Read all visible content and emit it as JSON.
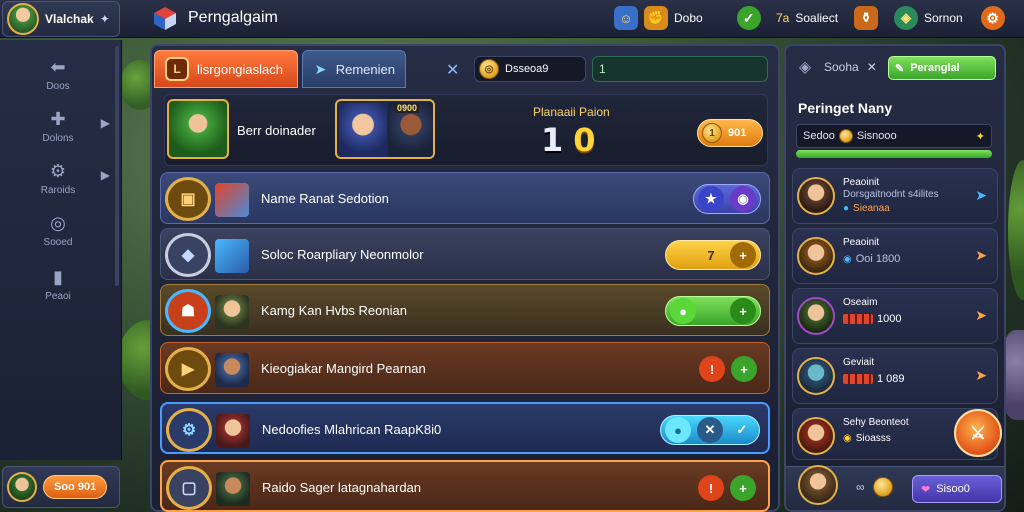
{
  "topbar": {
    "player_name": "Vlalchak",
    "player_gear": "✦",
    "app_title": "Perngalgaim",
    "res1_label": "Dobo",
    "res2_prefix": "7a",
    "res2_label": "Soaliect",
    "res3_label": "Sornon"
  },
  "left_rail": {
    "items": [
      {
        "label": "Doos",
        "icon": "back-arrow-icon"
      },
      {
        "label": "Dolons",
        "icon": "puzzle-icon"
      },
      {
        "label": "Raroids",
        "icon": "gear-people-icon"
      },
      {
        "label": "Sooed",
        "icon": "target-icon"
      },
      {
        "label": "Peaoi",
        "icon": "chart-icon"
      }
    ],
    "bottom_label": "Soo 901"
  },
  "main": {
    "tab_active": "lisrgongiaslach",
    "tab_active_emblem": "L",
    "tab_second": "Remenien",
    "close_symbol": "✕",
    "gold_coin_symbol": "◎",
    "gold_value": "Dsseoa9",
    "green_value": "1",
    "match": {
      "player_name": "Berr doinader",
      "opp_badge": "0900",
      "score_label": "Planaaii Paion",
      "score_left": "1",
      "score_right": "0",
      "reward_value": "901",
      "reward_coin": "1"
    },
    "quests": [
      {
        "title": "Name Ranat Sedotion",
        "emblem": "▣",
        "actions": [
          "★",
          "◉"
        ]
      },
      {
        "title": "Soloc Roarpliary Neonmolor",
        "emblem": "◆",
        "actions": [
          "7",
          "+"
        ]
      },
      {
        "title": "Kamg Kan Hvbs Reonian",
        "emblem": "☗",
        "actions": [
          "●",
          "+"
        ]
      },
      {
        "title": "Kieogiakar Mangird Pearnan",
        "emblem": "▶",
        "actions": [
          "!",
          "+"
        ]
      },
      {
        "title": "Nedoofies Mlahrican RaapK8i0",
        "emblem": "⚙",
        "actions": [
          "●",
          "✕",
          "✓"
        ]
      },
      {
        "title": "Raido Sager latagnahardan",
        "emblem": "▢",
        "actions": [
          "!",
          "+"
        ]
      }
    ]
  },
  "right": {
    "tab_label": "Sooha",
    "tab_close": "✕",
    "green_btn": "Peranglal",
    "heading": "Peringet Nany",
    "search_label": "Sedoo",
    "search_value": "Sisnooo",
    "progress_pct": 100,
    "rows": [
      {
        "name": "Peaoinit",
        "sub": "Dorsgaitnodnt s4ilites",
        "meta": "Sieanaa",
        "arrow": "➤"
      },
      {
        "name": "Peaoinit",
        "sub": "",
        "meta": "Ooi 1800",
        "arrow": "➤"
      },
      {
        "name": "Oseaim",
        "sub": "",
        "meta": "1000",
        "arrow": "➤"
      },
      {
        "name": "Geviait",
        "sub": "",
        "meta": "1 089",
        "arrow": "➤"
      },
      {
        "name": "Sehy Beonteot",
        "sub": "",
        "meta": "Sioasss",
        "arrow": ""
      }
    ],
    "bottom_pill": "Sisoo0"
  },
  "colors": {
    "accent_orange": "#e0501a",
    "accent_green": "#3aa52a",
    "accent_blue": "#4a8bd8",
    "accent_purple": "#4436a8"
  }
}
